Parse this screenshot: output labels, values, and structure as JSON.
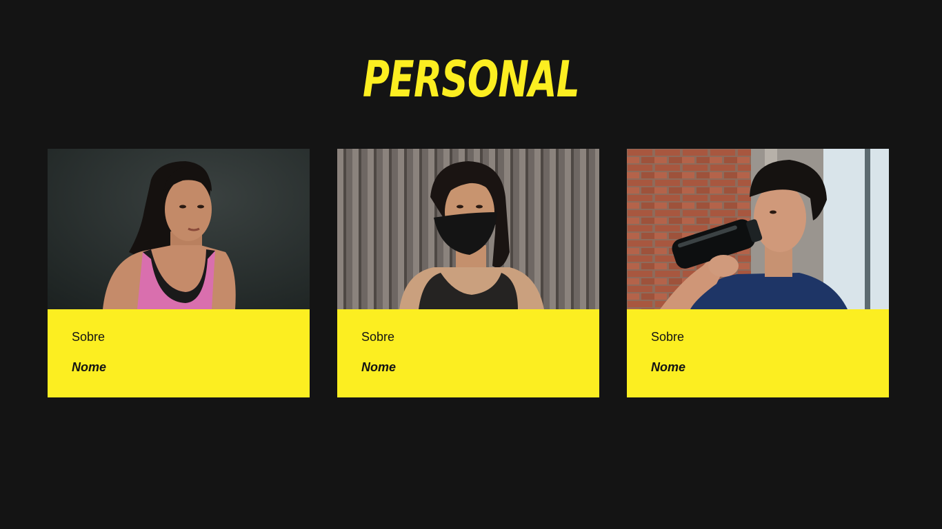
{
  "colors": {
    "background": "#141414",
    "accent": "#FCEE21",
    "text_dark": "#141414"
  },
  "page": {
    "title": "PERSONAL"
  },
  "cards": [
    {
      "about_label": "Sobre",
      "name_label": "Nome",
      "photo_icon": "woman-in-pink-tank-top-photo"
    },
    {
      "about_label": "Sobre",
      "name_label": "Nome",
      "photo_icon": "woman-with-black-face-mask-photo"
    },
    {
      "about_label": "Sobre",
      "name_label": "Nome",
      "photo_icon": "man-drinking-from-shaker-photo"
    }
  ]
}
